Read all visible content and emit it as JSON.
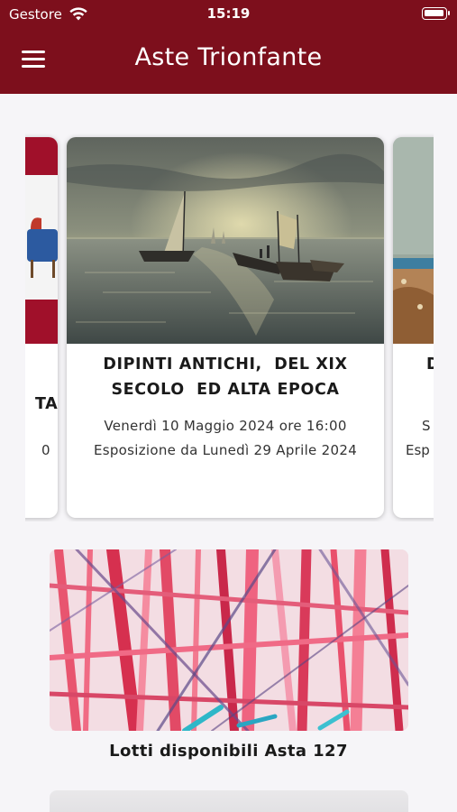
{
  "status_bar": {
    "carrier": "Gestore",
    "time": "15:19"
  },
  "header": {
    "title": "Aste Trionfante"
  },
  "auctions": {
    "current": {
      "title_line1": "DIPINTI ANTICHI,  DEL XIX",
      "title_line2": "SECOLO  ED ALTA EPOCA",
      "date": "Venerdì 10 Maggio 2024 ore 16:00",
      "exhibition": "Esposizione da Lunedì 29 Aprile 2024"
    },
    "previous_partial": {
      "title_fragment": "TA",
      "date_fragment": "0"
    },
    "next_partial": {
      "title_fragment": "D",
      "date_fragment": "S",
      "exhibition_fragment": "Esp"
    }
  },
  "banner": {
    "caption": "Lotti disponibili Asta 127"
  },
  "colors": {
    "header": "#7d0f1c",
    "background": "#f6f5f8",
    "card": "#ffffff"
  }
}
